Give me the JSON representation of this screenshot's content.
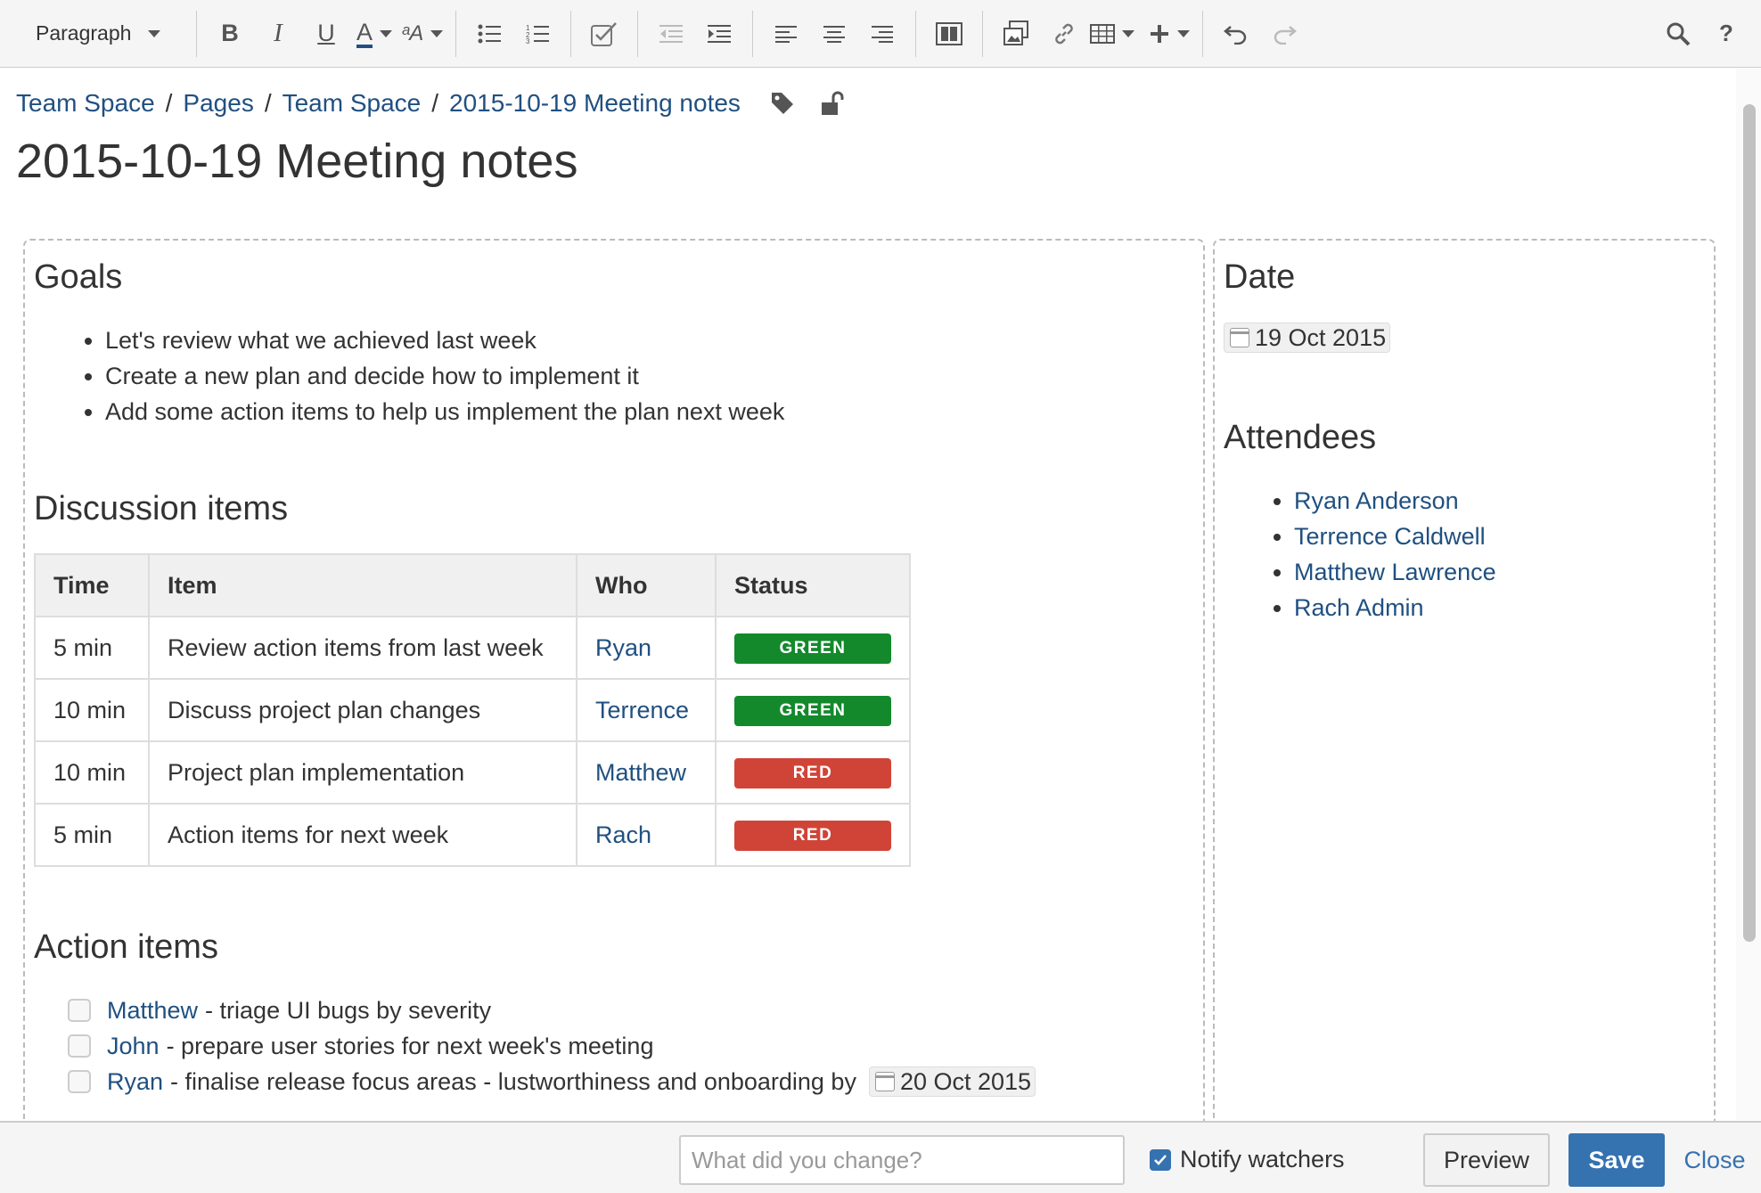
{
  "toolbar": {
    "paragraph_label": "Paragraph",
    "help_label": "?"
  },
  "breadcrumb": [
    {
      "label": "Team Space"
    },
    {
      "label": "Pages"
    },
    {
      "label": "Team Space"
    },
    {
      "label": "2015-10-19 Meeting notes"
    }
  ],
  "page": {
    "title": "2015-10-19 Meeting notes"
  },
  "goals": {
    "heading": "Goals",
    "items": [
      "Let's review what we achieved last week",
      "Create a new plan and decide how to implement it",
      "Add some action items to help us implement the plan next week"
    ]
  },
  "discussion": {
    "heading": "Discussion items",
    "columns": [
      "Time",
      "Item",
      "Who",
      "Status"
    ],
    "rows": [
      {
        "time": "5 min",
        "item": "Review action items from last week",
        "who": "Ryan",
        "status": "GREEN"
      },
      {
        "time": "10 min",
        "item": "Discuss project plan changes",
        "who": "Terrence",
        "status": "GREEN"
      },
      {
        "time": "10 min",
        "item": "Project plan implementation",
        "who": "Matthew",
        "status": "RED"
      },
      {
        "time": "5 min",
        "item": "Action items for next week",
        "who": "Rach",
        "status": "RED"
      }
    ]
  },
  "actions": {
    "heading": "Action items",
    "items": [
      {
        "who": "Matthew",
        "text": "- triage UI bugs by severity",
        "date": ""
      },
      {
        "who": "John",
        "text": "- prepare user stories for next week's meeting",
        "date": ""
      },
      {
        "who": "Ryan",
        "text": "- finalise release focus areas - lustworthiness and onboarding by",
        "date": "20 Oct 2015"
      }
    ]
  },
  "sidebar": {
    "date_heading": "Date",
    "date_value": "19 Oct 2015",
    "attendees_heading": "Attendees",
    "attendees": [
      "Ryan Anderson",
      "Terrence Caldwell",
      "Matthew Lawrence",
      "Rach Admin"
    ]
  },
  "footer": {
    "change_placeholder": "What did you change?",
    "notify_label": "Notify watchers",
    "notify_checked": true,
    "preview_label": "Preview",
    "save_label": "Save",
    "close_label": "Close"
  },
  "colors": {
    "link": "#205081",
    "status_green": "#14892c",
    "status_red": "#d04437",
    "primary": "#3572b0"
  },
  "icons": {
    "toolbar": [
      "bold-icon",
      "italic-icon",
      "underline-icon",
      "text-color-icon",
      "text-format-icon",
      "bullet-list-icon",
      "numbered-list-icon",
      "task-list-icon",
      "outdent-icon",
      "indent-icon",
      "align-left-icon",
      "align-center-icon",
      "align-right-icon",
      "page-layout-icon",
      "insert-image-icon",
      "link-icon",
      "table-icon",
      "insert-plus-icon",
      "undo-icon",
      "redo-icon",
      "search-icon",
      "help-icon"
    ],
    "breadcrumb": [
      "label-tag-icon",
      "unlock-icon"
    ]
  }
}
